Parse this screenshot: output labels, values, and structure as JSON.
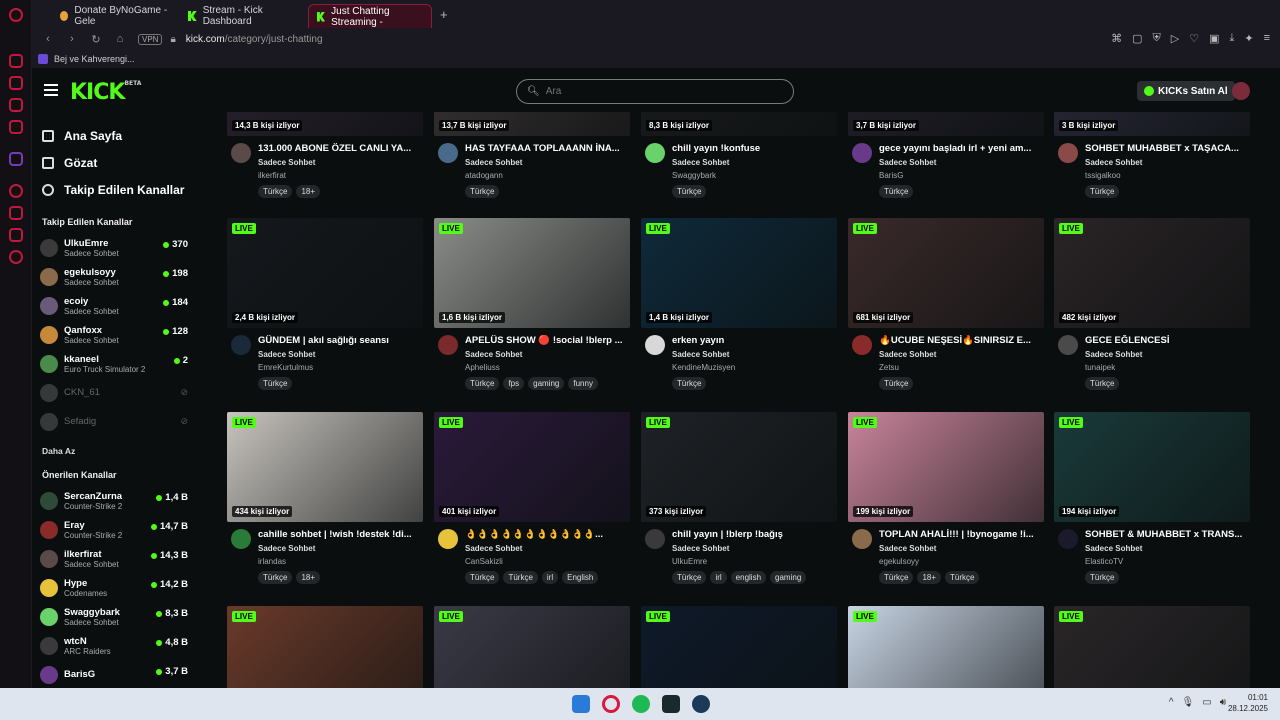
{
  "browser": {
    "tabs": [
      {
        "label": "Donate ByNoGame - Gele",
        "active": false
      },
      {
        "label": "Stream - Kick Dashboard",
        "active": false
      },
      {
        "label": "Just Chatting Streaming -",
        "active": true
      }
    ],
    "url_host": "kick.com",
    "url_path": "/category/just-chatting",
    "vpn_label": "VPN",
    "bookmark": "Bej ve Kahverengi..."
  },
  "header": {
    "logo": "KICK",
    "logo_sup": "BETA",
    "search_placeholder": "Ara",
    "buy_label": "KICKs Satın Al"
  },
  "sidebar": {
    "nav": [
      {
        "label": "Ana Sayfa"
      },
      {
        "label": "Gözat"
      },
      {
        "label": "Takip Edilen Kanallar"
      }
    ],
    "followed_title": "Takip Edilen Kanallar",
    "followed": [
      {
        "name": "UlkuEmre",
        "category": "Sadece Sohbet",
        "count": "370",
        "color": "#3a3a3a"
      },
      {
        "name": "egekulsoyy",
        "category": "Sadece Sohbet",
        "count": "198",
        "color": "#8a6a4a"
      },
      {
        "name": "ecoiy",
        "category": "Sadece Sohbet",
        "count": "184",
        "color": "#6a5a7a"
      },
      {
        "name": "Qanfoxx",
        "category": "Sadece Sohbet",
        "count": "128",
        "color": "#c48a3a"
      },
      {
        "name": "kkaneel",
        "category": "Euro Truck Simulator 2",
        "count": "2",
        "color": "#4a8a4a"
      },
      {
        "name": "CKN_61",
        "category": "",
        "count": "",
        "color": "#777777",
        "offline": true
      },
      {
        "name": "Sefadig",
        "category": "",
        "count": "",
        "color": "#777777",
        "offline": true
      }
    ],
    "more_label": "Daha Az",
    "recommended_title": "Önerilen Kanallar",
    "recommended": [
      {
        "name": "SercanZurna",
        "category": "Counter-Strike 2",
        "count": "1,4 B",
        "color": "#2e4a3a"
      },
      {
        "name": "Eray",
        "category": "Counter-Strike 2",
        "count": "14,7 B",
        "color": "#8a2a2a"
      },
      {
        "name": "ilkerfirat",
        "category": "Sadece Sohbet",
        "count": "14,3 B",
        "color": "#5a4a4a"
      },
      {
        "name": "Hype",
        "category": "Codenames",
        "count": "14,2 B",
        "color": "#e8c23a"
      },
      {
        "name": "Swaggybark",
        "category": "Sadece Sohbet",
        "count": "8,3 B",
        "color": "#6ad26a"
      },
      {
        "name": "wtcN",
        "category": "ARC Raiders",
        "count": "4,8 B",
        "color": "#3a3a3a"
      },
      {
        "name": "BarisG",
        "category": "",
        "count": "3,7 B",
        "color": "#6a3a8a"
      }
    ]
  },
  "cards": [
    {
      "viewers": "14,3 B kişi izliyor",
      "title": "131.000 ABONE ÖZEL CANLI YA...",
      "category": "Sadece Sohbet",
      "user": "ilkerfirat",
      "tags": [
        "Türkçe",
        "18+"
      ],
      "live": false,
      "thumb": "#2a2230",
      "avatar": "#5a4a4a"
    },
    {
      "viewers": "13,7 B kişi izliyor",
      "title": "HAS TAYFAAA TOPLAAANN İNA...",
      "category": "Sadece Sohbet",
      "user": "atadogann",
      "tags": [
        "Türkçe"
      ],
      "live": false,
      "thumb": "#3a3536",
      "avatar": "#4a6a8a"
    },
    {
      "viewers": "8,3 B kişi izliyor",
      "title": "chill yayın !konfuse",
      "category": "Sadece Sohbet",
      "user": "Swaggybark",
      "tags": [
        "Türkçe"
      ],
      "live": false,
      "thumb": "#1a1c1e",
      "avatar": "#6ad26a"
    },
    {
      "viewers": "3,7 B kişi izliyor",
      "title": "gece yayını başladı irl + yeni am...",
      "category": "Sadece Sohbet",
      "user": "BarisG",
      "tags": [
        "Türkçe"
      ],
      "live": false,
      "thumb": "#22202a",
      "avatar": "#6a3a8a"
    },
    {
      "viewers": "3 B kişi izliyor",
      "title": "SOHBET MUHABBET x TAŞACA...",
      "category": "Sadece Sohbet",
      "user": "tssigalkoo",
      "tags": [
        "Türkçe"
      ],
      "live": false,
      "thumb": "#2a2a3a",
      "avatar": "#8a4a4a"
    },
    {
      "viewers": "2,4 B kişi izliyor",
      "title": "GÜNDEM | akıl sağlığı seansı",
      "category": "Sadece Sohbet",
      "user": "EmreKurtulmus",
      "tags": [
        "Türkçe"
      ],
      "live": true,
      "thumb": "#15181c",
      "avatar": "#1a2a3a",
      "label": "LIVE"
    },
    {
      "viewers": "1,6 B kişi izliyor",
      "title": "APELÜS SHOW 🔴 !social !blerp ...",
      "category": "Sadece Sohbet",
      "user": "Apheliuss",
      "tags": [
        "Türkçe",
        "fps",
        "gaming",
        "funny"
      ],
      "live": true,
      "thumb": "#8a8c88",
      "avatar": "#7a2a2a",
      "label": "LIVE"
    },
    {
      "viewers": "1,4 B kişi izliyor",
      "title": "erken yayın",
      "category": "Sadece Sohbet",
      "user": "KendineMuzisyen",
      "tags": [
        "Türkçe"
      ],
      "live": true,
      "thumb": "#0e2a3a",
      "avatar": "#d8d8d8",
      "label": "LIVE"
    },
    {
      "viewers": "681 kişi izliyor",
      "title": "🔥UCUBE NEŞESİ🔥SINIRSIZ E...",
      "category": "Sadece Sohbet",
      "user": "Zetsu",
      "tags": [
        "Türkçe"
      ],
      "live": true,
      "thumb": "#3a2a2a",
      "avatar": "#8a2a2a",
      "label": "LIVE"
    },
    {
      "viewers": "482 kişi izliyor",
      "title": "GECE EĞLENCESİ",
      "category": "Sadece Sohbet",
      "user": "tunaipek",
      "tags": [
        "Türkçe"
      ],
      "live": true,
      "thumb": "#2a2426",
      "avatar": "#4a4a4a",
      "label": "LIVE"
    },
    {
      "viewers": "434 kişi izliyor",
      "title": "cahille sohbet | !wish !destek !di...",
      "category": "Sadece Sohbet",
      "user": "irlandas",
      "tags": [
        "Türkçe",
        "18+"
      ],
      "live": true,
      "thumb": "#c8c4be",
      "avatar": "#2a7a3a",
      "label": "LIVE"
    },
    {
      "viewers": "401 kişi izliyor",
      "title": "👌👌👌👌👌👌👌👌👌👌👌...",
      "category": "Sadece Sohbet",
      "user": "CanSakizli",
      "tags": [
        "Türkçe",
        "Türkçe",
        "irl",
        "English"
      ],
      "live": true,
      "thumb": "#2a1a3a",
      "avatar": "#e8c23a",
      "label": "LIVE"
    },
    {
      "viewers": "373 kişi izliyor",
      "title": "chill yayın | !blerp !bağış",
      "category": "Sadece Sohbet",
      "user": "UlkuEmre",
      "tags": [
        "Türkçe",
        "irl",
        "english",
        "gaming"
      ],
      "live": true,
      "thumb": "#1e2226",
      "avatar": "#3a3a3a",
      "label": "LIVE"
    },
    {
      "viewers": "199 kişi izliyor",
      "title": "TOPLAN AHALİ!!! | !bynogame !i...",
      "category": "Sadece Sohbet",
      "user": "egekulsoyy",
      "tags": [
        "Türkçe",
        "18+",
        "Türkçe"
      ],
      "live": true,
      "thumb": "#c8849a",
      "avatar": "#8a6a4a",
      "label": "LIVE"
    },
    {
      "viewers": "194 kişi izliyor",
      "title": "SOHBET & MUHABBET x TRANS...",
      "category": "Sadece Sohbet",
      "user": "ElasticoTV",
      "tags": [
        "Türkçe"
      ],
      "live": true,
      "thumb": "#1a3a3a",
      "avatar": "#1a1a2a",
      "label": "LIVE"
    },
    {
      "viewers": "",
      "title": "",
      "category": "",
      "user": "",
      "tags": [],
      "live": true,
      "thumb": "#6a3a2a",
      "avatar": "",
      "label": "LIVE"
    },
    {
      "viewers": "",
      "title": "",
      "category": "",
      "user": "",
      "tags": [],
      "live": true,
      "thumb": "#3a3a46",
      "avatar": "",
      "label": "LIVE"
    },
    {
      "viewers": "",
      "title": "",
      "category": "",
      "user": "",
      "tags": [],
      "live": true,
      "thumb": "#0e1a2a",
      "avatar": "",
      "label": "LIVE"
    },
    {
      "viewers": "",
      "title": "",
      "category": "",
      "user": "",
      "tags": [],
      "live": true,
      "thumb": "#c8d4e4",
      "avatar": "",
      "label": "LIVE"
    },
    {
      "viewers": "",
      "title": "",
      "category": "",
      "user": "",
      "tags": [],
      "live": true,
      "thumb": "#2a2628",
      "avatar": "",
      "label": "LIVE"
    }
  ],
  "taskbar": {
    "time": "01:01",
    "date": "28.12.2025"
  }
}
